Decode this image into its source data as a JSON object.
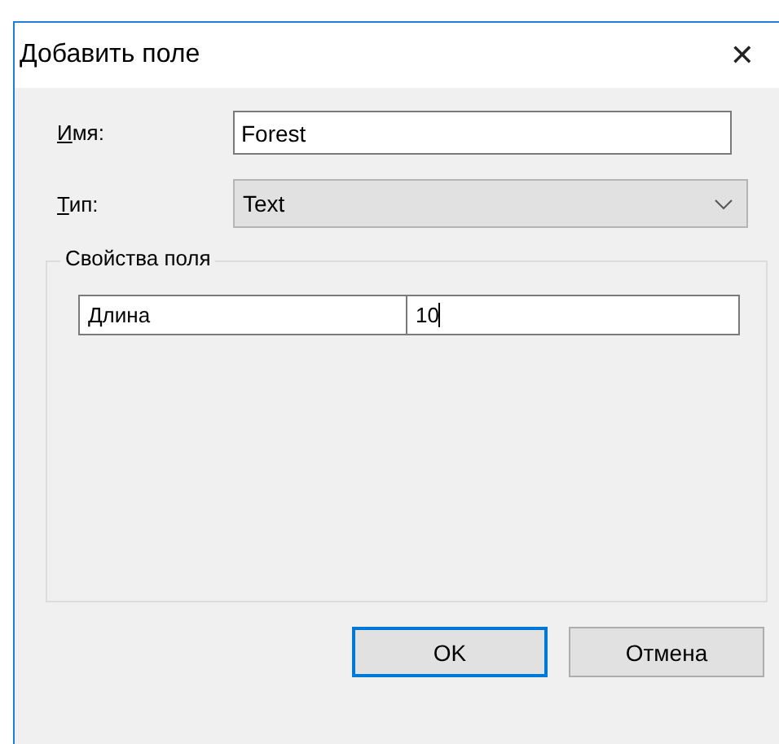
{
  "window": {
    "title": "Добавить поле",
    "close": "✕"
  },
  "fields": [
    {
      "kind": "text",
      "mnemonic": "И",
      "label_rest": "мя:",
      "value": "Forest"
    },
    {
      "kind": "dropdown",
      "mnemonic": "Т",
      "label_rest": "ип:",
      "value": "Text"
    }
  ],
  "group": {
    "title": "Свойства поля",
    "properties": [
      {
        "name": "Длина",
        "value": "10",
        "focused": true
      }
    ]
  },
  "buttons": [
    {
      "label": "OK",
      "default": true
    },
    {
      "label": "Отмена",
      "default": false
    }
  ]
}
